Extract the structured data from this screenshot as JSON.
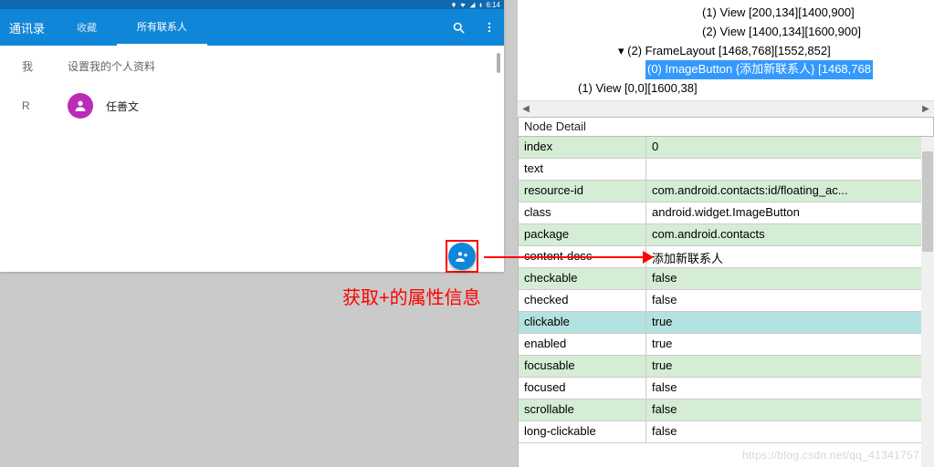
{
  "status_bar": {
    "time": "6:14"
  },
  "app": {
    "title": "通讯录",
    "tabs": {
      "fav": "收藏",
      "all": "所有联系人"
    }
  },
  "profile_row": {
    "letter": "我",
    "text": "设置我的个人资料"
  },
  "contact_row": {
    "letter": "R",
    "name": "任善文"
  },
  "caption": "获取+的属性信息",
  "tree": {
    "l0": "(1) View [200,134][1400,900]",
    "l1": "(2) View [1400,134][1600,900]",
    "l2": "(2) FrameLayout [1468,768][1552,852]",
    "l3": "(0) ImageButton {添加新联系人} [1468,768",
    "l4": "(1) View [0,0][1600,38]"
  },
  "detail_header": "Node Detail",
  "props": [
    {
      "k": "index",
      "v": "0",
      "g": true
    },
    {
      "k": "text",
      "v": "",
      "g": false
    },
    {
      "k": "resource-id",
      "v": "com.android.contacts:id/floating_ac...",
      "g": true
    },
    {
      "k": "class",
      "v": "android.widget.ImageButton",
      "g": false
    },
    {
      "k": "package",
      "v": "com.android.contacts",
      "g": true
    },
    {
      "k": "content-desc",
      "v": "添加新联系人",
      "g": false
    },
    {
      "k": "checkable",
      "v": "false",
      "g": true
    },
    {
      "k": "checked",
      "v": "false",
      "g": false
    },
    {
      "k": "clickable",
      "v": "true",
      "g": false,
      "hl": true
    },
    {
      "k": "enabled",
      "v": "true",
      "g": false
    },
    {
      "k": "focusable",
      "v": "true",
      "g": true
    },
    {
      "k": "focused",
      "v": "false",
      "g": false
    },
    {
      "k": "scrollable",
      "v": "false",
      "g": true
    },
    {
      "k": "long-clickable",
      "v": "false",
      "g": false
    }
  ],
  "watermark": "https://blog.csdn.net/qq_41341757"
}
